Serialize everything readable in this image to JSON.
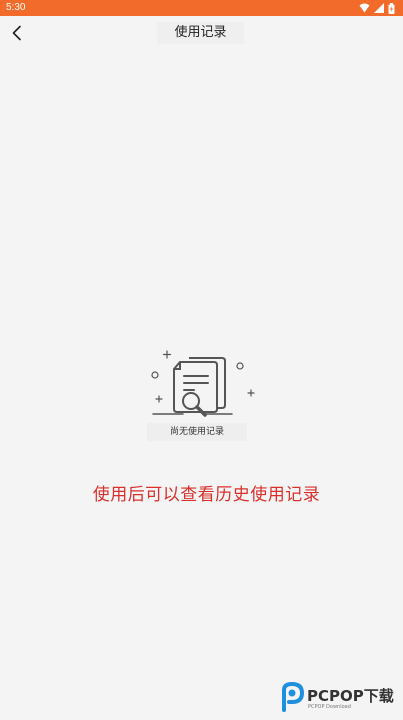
{
  "status_bar": {
    "time": "5:30",
    "color": "#f36b2a"
  },
  "header": {
    "title": "使用记录",
    "back_icon": "chevron-left-icon"
  },
  "empty_state": {
    "icon": "document-search-icon",
    "label": "尚无使用记录"
  },
  "hint": {
    "text": "使用后可以查看历史使用记录",
    "color": "#d9302c"
  },
  "watermark": {
    "brand": "PCPOP下载",
    "sub": "PCPOP Download"
  }
}
